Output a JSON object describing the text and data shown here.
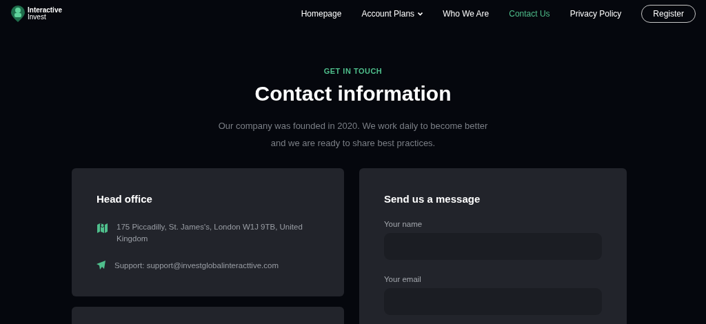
{
  "logo": {
    "line1": "Interactive",
    "line2": "Invest"
  },
  "nav": [
    {
      "label": "Homepage",
      "selected": false,
      "dropdown": false
    },
    {
      "label": "Account Plans",
      "selected": false,
      "dropdown": true
    },
    {
      "label": "Who We Are",
      "selected": false,
      "dropdown": false
    },
    {
      "label": "Contact Us",
      "selected": true,
      "dropdown": false
    },
    {
      "label": "Privacy Policy",
      "selected": false,
      "dropdown": false
    }
  ],
  "register_button": "Register",
  "hero": {
    "eyebrow": "GET IN TOUCH",
    "title": "Contact information",
    "text": "Our company was founded in 2020. We work daily to become better and we are ready to share best practices."
  },
  "head_office": {
    "title": "Head office",
    "items": [
      {
        "kind": "address",
        "text": "175 Piccadilly, St. James's, London W1J 9TB, United Kingdom"
      },
      {
        "kind": "email",
        "text": "Support: support@investglobalinteracttive.com"
      }
    ]
  },
  "message_form": {
    "title": "Send us a message",
    "fields": [
      {
        "label": "Your name"
      },
      {
        "label": "Your email"
      }
    ]
  }
}
